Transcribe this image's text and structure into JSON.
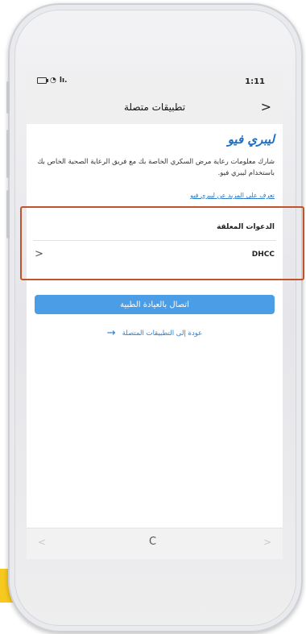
{
  "status_bar": {
    "time": "1:11",
    "wifi_icon": "wifi-icon",
    "signal_icon": "signal-icon",
    "signal_text": "lı.",
    "battery_icon": "battery-icon"
  },
  "nav": {
    "title": "تطبيقات متصلة",
    "back_glyph": ">"
  },
  "app": {
    "name": "ليبري فيو",
    "description": "شارك معلومات رعاية مرض السكري الخاصة بك مع فريق الرعاية الصحية الخاص بك باستخدام ليبري فيو.",
    "learn_more": "تعرف على المزيد عن ليبري فيو"
  },
  "invites": {
    "title": "الدعوات المعلقة",
    "items": [
      {
        "name": "DHCC",
        "chevron": "<"
      }
    ]
  },
  "actions": {
    "connect_label": "اتصال بالعيادة الطبية",
    "back_label": "عودة إلى التطبيقات المتصلة",
    "back_arrow": "→"
  },
  "browser": {
    "back": "<",
    "forward": ">",
    "reload": "C"
  },
  "colors": {
    "accent": "#4b9de6",
    "link": "#2a7ccc",
    "title": "#1d6fbf",
    "highlight": "#c0532b",
    "badge": "#f7c81e"
  }
}
